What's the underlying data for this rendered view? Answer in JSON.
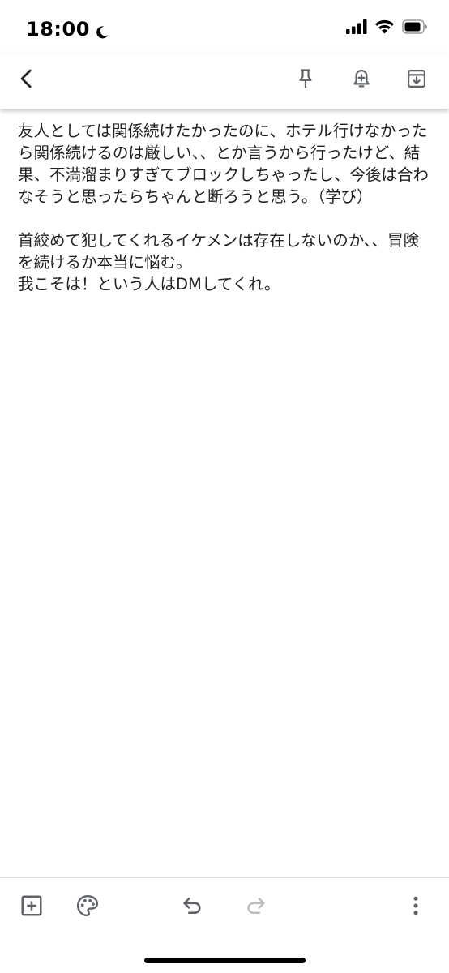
{
  "status_bar": {
    "time": "18:00",
    "icons": [
      "moon-icon",
      "signal-icon",
      "wifi-icon",
      "battery-icon"
    ]
  },
  "toolbar": {
    "icons": [
      "back-icon",
      "pin-icon",
      "reminder-bell-icon",
      "archive-icon"
    ]
  },
  "note": {
    "text": "友人としては関係続けたかったのに、ホテル行けなかったら関係続けるのは厳しい、、とか言うから行ったけど、結果、不満溜まりすぎてブロックしちゃったし、今後は合わなそうと思ったらちゃんと断ろうと思う。（学び）\n\n首絞めて犯してくれるイケメンは存在しないのか、、冒険を続けるか本当に悩む。\n我こそは！という人はDMしてくれ。"
  },
  "bottom_bar": {
    "icons": [
      "add-box-icon",
      "palette-icon",
      "undo-icon",
      "redo-icon",
      "more-vert-icon"
    ],
    "redo_enabled": false
  },
  "colors": {
    "text": "#202124",
    "icon": "#5f6368",
    "disabled_icon": "#bdbdbd",
    "background": "#ffffff"
  }
}
